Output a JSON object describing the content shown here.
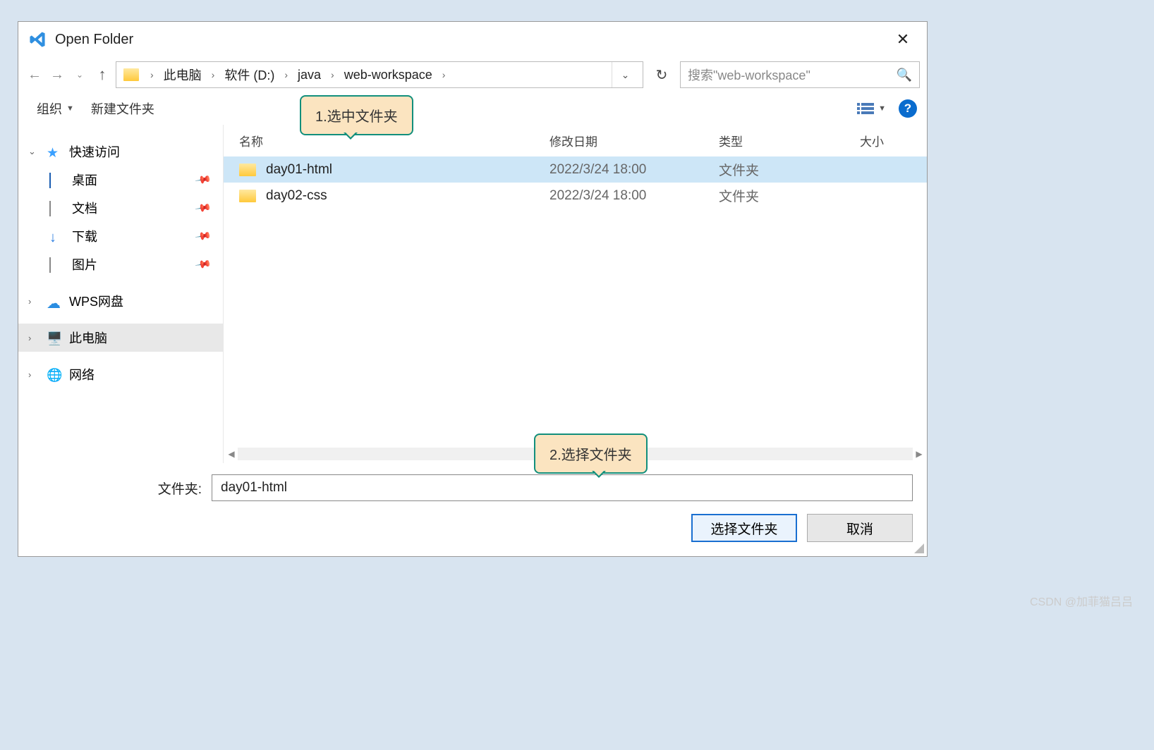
{
  "title": "Open Folder",
  "breadcrumb": {
    "seg0": "此电脑",
    "seg1": "软件 (D:)",
    "seg2": "java",
    "seg3": "web-workspace"
  },
  "search": {
    "placeholder": "搜索\"web-workspace\""
  },
  "toolbar": {
    "organize": "组织",
    "newfolder": "新建文件夹"
  },
  "columns": {
    "name": "名称",
    "date": "修改日期",
    "type": "类型",
    "size": "大小"
  },
  "sidebar": {
    "quick": "快速访问",
    "desktop": "桌面",
    "docs": "文档",
    "downloads": "下载",
    "pictures": "图片",
    "wps": "WPS网盘",
    "thispc": "此电脑",
    "network": "网络"
  },
  "rows": [
    {
      "name": "day01-html",
      "date": "2022/3/24 18:00",
      "type": "文件夹",
      "selected": true
    },
    {
      "name": "day02-css",
      "date": "2022/3/24 18:00",
      "type": "文件夹",
      "selected": false
    }
  ],
  "callouts": {
    "c1": "1.选中文件夹",
    "c2": "2.选择文件夹"
  },
  "footer": {
    "label": "文件夹:",
    "value": "day01-html",
    "select": "选择文件夹",
    "cancel": "取消"
  },
  "watermark": "CSDN @加菲猫吕吕"
}
